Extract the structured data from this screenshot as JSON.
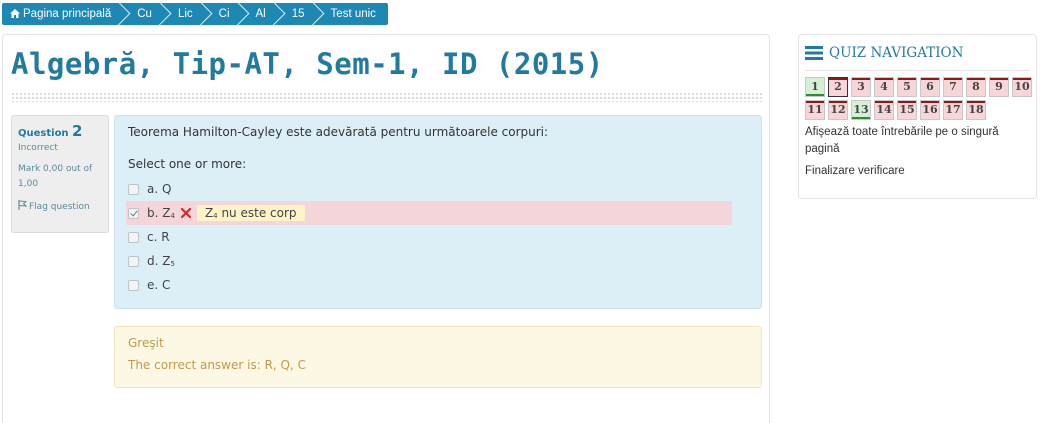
{
  "breadcrumb": [
    {
      "label": "Pagina principală",
      "icon": "home-icon"
    },
    {
      "label": "Cu"
    },
    {
      "label": "Lic"
    },
    {
      "label": "Ci"
    },
    {
      "label": "Al"
    },
    {
      "label": "15"
    },
    {
      "label": "Test unic"
    }
  ],
  "page": {
    "title": "Algebră, Tip-AT, Sem-1, ID (2015)"
  },
  "question": {
    "label": "Question",
    "number": "2",
    "state": "Incorrect",
    "grade": "Mark 0,00 out of 1,00",
    "flag": "Flag question",
    "text": "Teorema Hamilton-Cayley este adevărată pentru următoarele corpuri:",
    "prompt": "Select one or more:",
    "answers": [
      {
        "label": "a. Q",
        "checked": false
      },
      {
        "label": "b. Z",
        "sub": "4",
        "checked": true,
        "feedback": "Z",
        "feedback_sub": "4",
        "feedback_rest": " nu este corp"
      },
      {
        "label": "c. R",
        "checked": false
      },
      {
        "label": "d. Z",
        "sub": "5",
        "checked": false
      },
      {
        "label": "e. C",
        "checked": false
      }
    ]
  },
  "outcome": {
    "feedback": "Greşit",
    "right_answer": "The correct answer is: R, Q, C"
  },
  "quiz_nav": {
    "title": "QUIZ NAVIGATION",
    "buttons": [
      {
        "n": "1",
        "status": "correct"
      },
      {
        "n": "2",
        "status": "incorrect",
        "current": true
      },
      {
        "n": "3",
        "status": "incorrect"
      },
      {
        "n": "4",
        "status": "incorrect"
      },
      {
        "n": "5",
        "status": "incorrect"
      },
      {
        "n": "6",
        "status": "incorrect"
      },
      {
        "n": "7",
        "status": "incorrect"
      },
      {
        "n": "8",
        "status": "incorrect"
      },
      {
        "n": "9",
        "status": "incorrect"
      },
      {
        "n": "10",
        "status": "incorrect"
      },
      {
        "n": "11",
        "status": "incorrect"
      },
      {
        "n": "12",
        "status": "incorrect"
      },
      {
        "n": "13",
        "status": "correct"
      },
      {
        "n": "14",
        "status": "incorrect"
      },
      {
        "n": "15",
        "status": "incorrect"
      },
      {
        "n": "16",
        "status": "incorrect"
      },
      {
        "n": "17",
        "status": "incorrect"
      },
      {
        "n": "18",
        "status": "incorrect"
      }
    ],
    "show_all": "Afişează toate întrebările pe o singură pagină",
    "finish": "Finalizare verificare"
  },
  "colors": {
    "accent": "#237aa0",
    "breadcrumb_bg": "#1e88b4",
    "incorrect_bg": "#f4d6da",
    "formulation_bg": "#dceff6",
    "outcome_bg": "#fcf8e3"
  }
}
